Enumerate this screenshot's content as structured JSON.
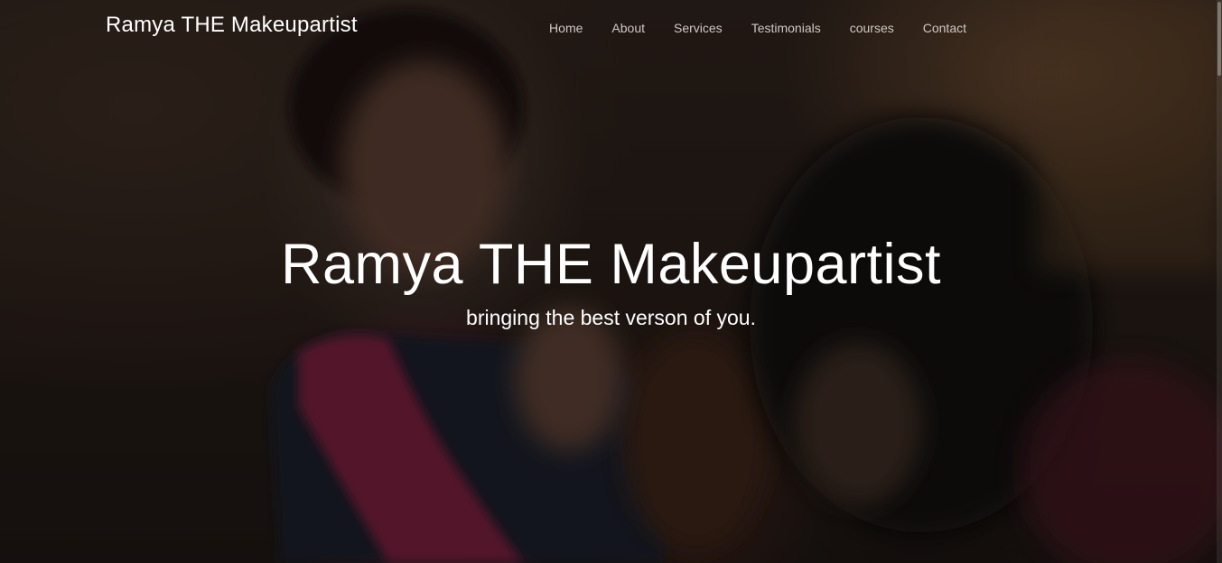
{
  "brand": {
    "name": "Ramya THE Makeupartist"
  },
  "nav": {
    "items": [
      {
        "label": "Home"
      },
      {
        "label": "About"
      },
      {
        "label": "Services"
      },
      {
        "label": "Testimonials"
      },
      {
        "label": "courses"
      },
      {
        "label": "Contact"
      }
    ]
  },
  "hero": {
    "title": "Ramya THE Makeupartist",
    "subtitle": "bringing the best verson of you."
  },
  "colors": {
    "text": "#ffffff",
    "nav_text": "#cfc8c4",
    "accent_pink": "#c81e5a"
  }
}
